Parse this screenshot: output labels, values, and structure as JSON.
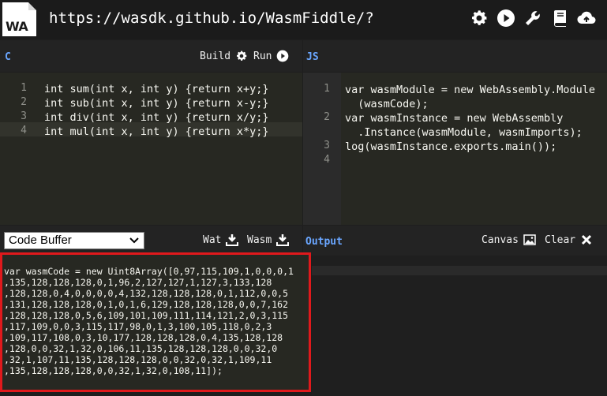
{
  "topbar": {
    "logo_text": "WA",
    "url": "https://wasdk.github.io/WasmFiddle/?",
    "icons": [
      "gear-icon",
      "play-icon",
      "wrench-icon",
      "book-icon",
      "upload-cloud-icon"
    ]
  },
  "c_panel": {
    "label": "C",
    "build_label": "Build",
    "run_label": "Run",
    "line_numbers": [
      "1",
      "2",
      "3",
      "4"
    ],
    "lines": [
      "int sum(int x, int y) {return x+y;}",
      "int sub(int x, int y) {return x-y;}",
      "int div(int x, int y) {return x/y;}",
      "int mul(int x, int y) {return x*y;}"
    ]
  },
  "js_panel": {
    "label": "JS",
    "line_numbers": [
      "1",
      "",
      "2",
      "",
      "3",
      "4"
    ],
    "lines": [
      "var wasmModule = new WebAssembly.Module",
      "  (wasmCode);",
      "var wasmInstance = new WebAssembly",
      "  .Instance(wasmModule, wasmImports);",
      "log(wasmInstance.exports.main());",
      ""
    ]
  },
  "buffer_panel": {
    "select_value": "Code Buffer",
    "wat_label": "Wat",
    "wasm_label": "Wasm",
    "lines": [
      "var wasmCode = new Uint8Array([0,97,115,109,1,0,0,0,1",
      ",135,128,128,128,0,1,96,2,127,127,1,127,3,133,128",
      ",128,128,0,4,0,0,0,0,4,132,128,128,128,0,1,112,0,0,5",
      ",131,128,128,128,0,1,0,1,6,129,128,128,128,0,0,7,162",
      ",128,128,128,0,5,6,109,101,109,111,114,121,2,0,3,115",
      ",117,109,0,0,3,115,117,98,0,1,3,100,105,118,0,2,3",
      ",109,117,108,0,3,10,177,128,128,128,0,4,135,128,128",
      ",128,0,0,32,1,32,0,106,11,135,128,128,128,0,0,32,0",
      ",32,1,107,11,135,128,128,128,0,0,32,0,32,1,109,11",
      ",135,128,128,128,0,0,32,1,32,0,108,11]);"
    ]
  },
  "output_panel": {
    "label": "Output",
    "canvas_label": "Canvas",
    "clear_label": "Clear"
  },
  "colors": {
    "accent": "#6aa6ff",
    "highlight_border": "#e0191c",
    "editor_bg": "#272822"
  }
}
